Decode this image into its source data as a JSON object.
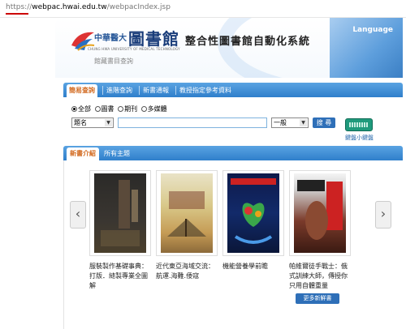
{
  "browser": {
    "url_protocol": "https://",
    "url_host": "webpac.hwai.edu.tw",
    "url_path": "/webpacIndex.jsp"
  },
  "header": {
    "language_label": "Language",
    "logo_cn": "中華醫大",
    "logo_big": "圖書館",
    "logo_en": "CHUNG HWA UNIVERSITY OF MEDICAL TECHNOLOGY",
    "system_title": "整合性圖書館自動化系統",
    "subtitle": "館藏書目查詢",
    "accent_color": "#3b7fc4"
  },
  "search": {
    "tabs": [
      {
        "label": "簡易查詢",
        "active": true
      },
      {
        "label": "進階查詢",
        "active": false
      },
      {
        "label": "新書通報",
        "active": false
      },
      {
        "label": "教授指定參考資料",
        "active": false
      }
    ],
    "material_types": [
      {
        "label": "全部",
        "checked": true
      },
      {
        "label": "圖書",
        "checked": false
      },
      {
        "label": "期刊",
        "checked": false
      },
      {
        "label": "多媒體",
        "checked": false
      }
    ],
    "field_select": "題名",
    "query_value": "",
    "match_mode": "一般",
    "search_button": "搜 尋",
    "keyboard_label": "鍵盤小鍵盤"
  },
  "new_books": {
    "tabs": [
      {
        "label": "新書介紹",
        "active": true
      },
      {
        "label": "所有主題",
        "active": false
      }
    ],
    "prev_icon": "‹",
    "next_icon": "›",
    "items": [
      {
        "title": "服裝製作基礎事典：打版．縫製專業全圖解"
      },
      {
        "title": "近代東亞海域交流：航運.海難.倭寇"
      },
      {
        "title": "機能營養學前瞻"
      },
      {
        "title": "帕維爾徒手戰士：俄式訓練大師，傳授你只用自體重量"
      }
    ],
    "more_button": "更多新鮮書"
  }
}
